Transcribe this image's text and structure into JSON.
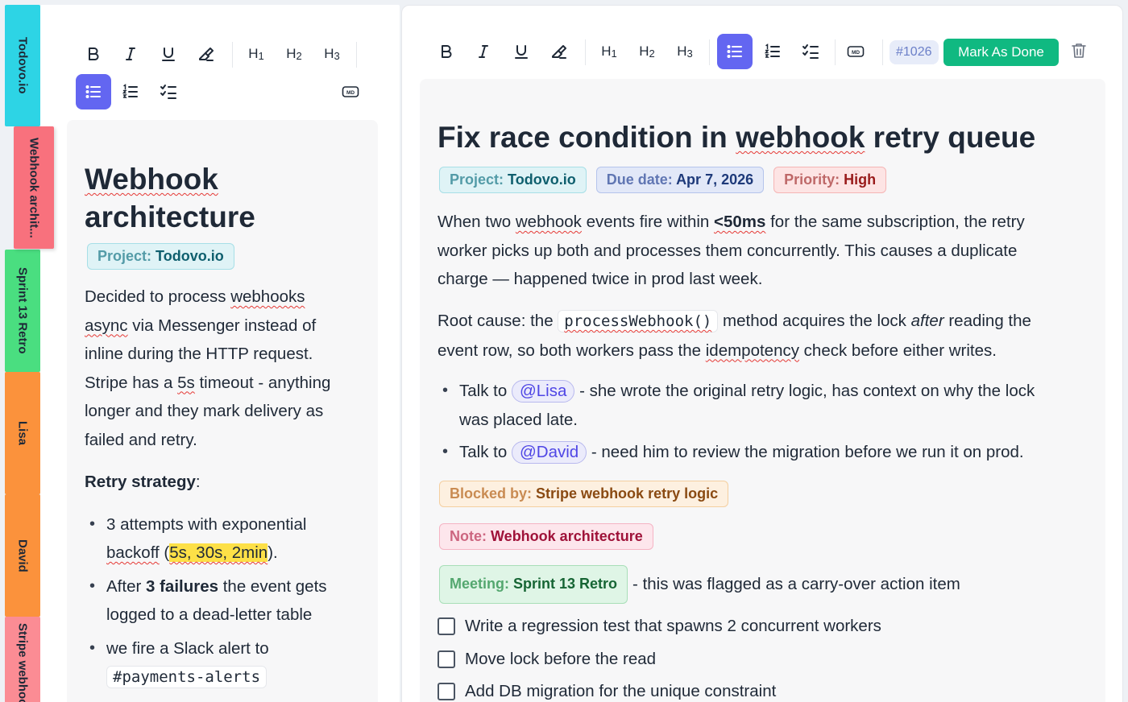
{
  "side_tabs": [
    {
      "label": "Todovo.io",
      "color": "#2dd4e5"
    },
    {
      "label": "Webhook archit...",
      "color": "#f8717d"
    },
    {
      "label": "Sprint 13 Retro",
      "color": "#4ade80"
    },
    {
      "label": "Lisa",
      "color": "#fb923c"
    },
    {
      "label": "David",
      "color": "#fb923c"
    },
    {
      "label": "Stripe webhoo",
      "color": "#fb8c94"
    }
  ],
  "toolbar": {
    "h1": "H1",
    "h2": "H2",
    "h3": "H3",
    "md": "MD"
  },
  "left_doc": {
    "title_line1": "Webhook",
    "title_line2": "architecture",
    "project_key": "Project:",
    "project_value": "Todovo.io",
    "para_l1a": "Decided to process ",
    "para_l1b": "webhooks",
    "para_l2a": "async",
    "para_l2b": " via Messenger instead of",
    "para_l3": "inline during the HTTP request.",
    "para_l4a": "Stripe has a ",
    "para_l4b": "5s",
    "para_l4c": " timeout - anything",
    "para_l5": "longer and they mark delivery as",
    "para_l6": "failed and retry.",
    "retry_heading": "Retry strategy",
    "retry_colon": ":",
    "b1_l1": "3 attempts with exponential",
    "b1_l2a": "backoff",
    "b1_l2b": " (",
    "b1_l2c": "5s, 30s, 2min",
    "b1_l2d": ").",
    "b2_l1a": "After ",
    "b2_l1b": "3 failures",
    "b2_l1c": " the event gets",
    "b2_l2": "logged to a dead-letter table",
    "b3_l1": "we fire a Slack alert to",
    "b3_code": "#payments-alerts"
  },
  "right_panel": {
    "issue_id": "#1026",
    "done_label": "Mark As Done",
    "title_a": "Fix race condition in ",
    "title_b": "webhook",
    "title_c": " retry queue",
    "project_key": "Project:",
    "project_value": "Todovo.io",
    "due_key": "Due date:",
    "due_value": "Apr 7, 2026",
    "priority_key": "Priority:",
    "priority_value": "High",
    "p1_l1a": "When two ",
    "p1_l1b": "webhook",
    "p1_l1c": " events fire within ",
    "p1_l1d": "<50ms",
    "p1_l1e": " for the same subscription, the retry",
    "p1_l2": "worker picks up both and processes them concurrently. This causes a duplicate",
    "p1_l3": "charge — happened twice in prod last week.",
    "p2_l1a": "Root cause: the ",
    "p2_code": "processWebhook()",
    "p2_l1b": " method acquires the lock ",
    "p2_l1c": "after",
    "p2_l1d": " reading the",
    "p2_l2a": "event row, so both workers pass the ",
    "p2_l2b": "idempotency",
    "p2_l2c": " check before either writes.",
    "li1_a": "Talk to ",
    "li1_mention": "@Lisa",
    "li1_b": " - she wrote the original retry logic, has context on why the lock",
    "li1_c": "was placed late.",
    "li2_a": "Talk to ",
    "li2_mention": "@David",
    "li2_b": " - need him to review the migration before we run it on prod.",
    "blocked_key": "Blocked by:",
    "blocked_value": "Stripe webhook retry logic",
    "note_key": "Note:",
    "note_value": "Webhook architecture",
    "meeting_key": "Meeting:",
    "meeting_value": "Sprint 13 Retro",
    "meeting_after": " - this was flagged as a carry-over action item",
    "checklist": [
      {
        "label": "Write a regression test that spawns 2 concurrent workers",
        "checked": false
      },
      {
        "label": "Move lock before the read",
        "checked": false
      },
      {
        "label": "Add DB migration for the unique constraint",
        "checked": false
      }
    ]
  },
  "colors": {
    "accent": "#6366f1",
    "done_button": "#10b981"
  }
}
